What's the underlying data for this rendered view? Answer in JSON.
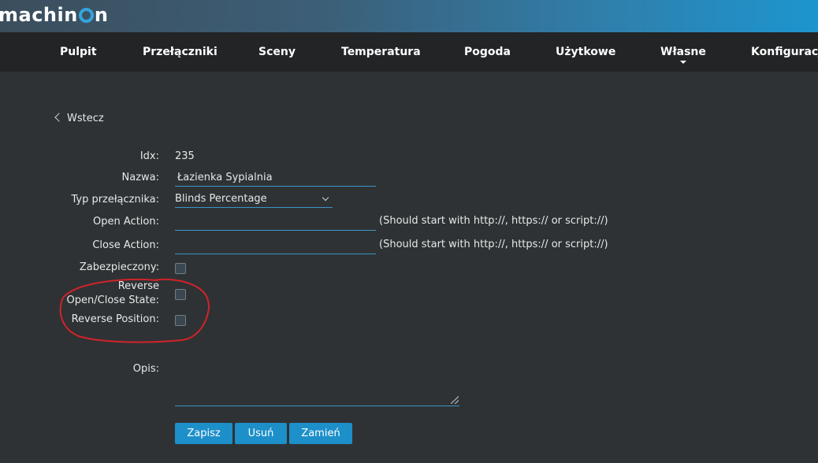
{
  "header": {
    "logo_prefix": "machin",
    "logo_suffix": "n"
  },
  "nav": {
    "items": [
      {
        "label": "Pulpit"
      },
      {
        "label": "Przełączniki"
      },
      {
        "label": "Sceny"
      },
      {
        "label": "Temperatura"
      },
      {
        "label": "Pogoda"
      },
      {
        "label": "Użytkowe"
      },
      {
        "label": "Własne"
      },
      {
        "label": "Konfiguracja"
      }
    ]
  },
  "back_label": "Wstecz",
  "form": {
    "idx_label": "Idx:",
    "idx_value": "235",
    "name_label": "Nazwa:",
    "name_value": "Łazienka Sypialnia",
    "type_label": "Typ przełącznika:",
    "type_value": "Blinds Percentage",
    "open_action_label": "Open Action:",
    "open_action_value": "",
    "close_action_label": "Close Action:",
    "close_action_value": "",
    "action_hint": "(Should start with http://, https:// or script://)",
    "protected_label": "Zabezpieczony:",
    "protected_checked": false,
    "reverse_state_label_1": "Reverse",
    "reverse_state_label_2": "Open/Close State:",
    "reverse_state_checked": false,
    "reverse_position_label": "Reverse Position:",
    "reverse_position_checked": false,
    "description_label": "Opis:",
    "description_value": ""
  },
  "buttons": {
    "save": "Zapisz",
    "delete": "Usuń",
    "replace": "Zamień"
  },
  "colors": {
    "accent": "#1d8fc9",
    "background": "#2f3234",
    "navbar": "#222426",
    "annotation": "#d0232a"
  }
}
